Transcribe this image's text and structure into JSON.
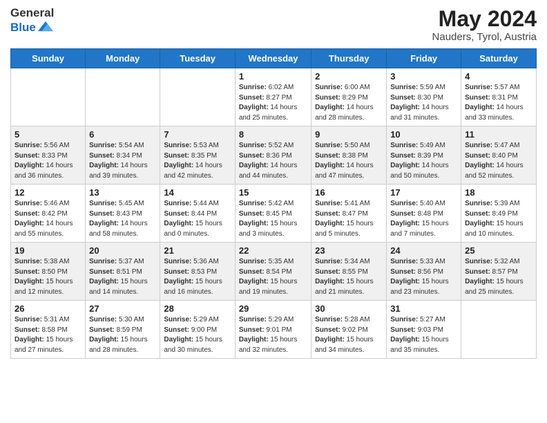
{
  "header": {
    "logo_text_general": "General",
    "logo_text_blue": "Blue",
    "month_year": "May 2024",
    "location": "Nauders, Tyrol, Austria"
  },
  "weekdays": [
    "Sunday",
    "Monday",
    "Tuesday",
    "Wednesday",
    "Thursday",
    "Friday",
    "Saturday"
  ],
  "weeks": [
    [
      {
        "day": "",
        "info": ""
      },
      {
        "day": "",
        "info": ""
      },
      {
        "day": "",
        "info": ""
      },
      {
        "day": "1",
        "info": "Sunrise: 6:02 AM\nSunset: 8:27 PM\nDaylight: 14 hours and 25 minutes."
      },
      {
        "day": "2",
        "info": "Sunrise: 6:00 AM\nSunset: 8:29 PM\nDaylight: 14 hours and 28 minutes."
      },
      {
        "day": "3",
        "info": "Sunrise: 5:59 AM\nSunset: 8:30 PM\nDaylight: 14 hours and 31 minutes."
      },
      {
        "day": "4",
        "info": "Sunrise: 5:57 AM\nSunset: 8:31 PM\nDaylight: 14 hours and 33 minutes."
      }
    ],
    [
      {
        "day": "5",
        "info": "Sunrise: 5:56 AM\nSunset: 8:33 PM\nDaylight: 14 hours and 36 minutes."
      },
      {
        "day": "6",
        "info": "Sunrise: 5:54 AM\nSunset: 8:34 PM\nDaylight: 14 hours and 39 minutes."
      },
      {
        "day": "7",
        "info": "Sunrise: 5:53 AM\nSunset: 8:35 PM\nDaylight: 14 hours and 42 minutes."
      },
      {
        "day": "8",
        "info": "Sunrise: 5:52 AM\nSunset: 8:36 PM\nDaylight: 14 hours and 44 minutes."
      },
      {
        "day": "9",
        "info": "Sunrise: 5:50 AM\nSunset: 8:38 PM\nDaylight: 14 hours and 47 minutes."
      },
      {
        "day": "10",
        "info": "Sunrise: 5:49 AM\nSunset: 8:39 PM\nDaylight: 14 hours and 50 minutes."
      },
      {
        "day": "11",
        "info": "Sunrise: 5:47 AM\nSunset: 8:40 PM\nDaylight: 14 hours and 52 minutes."
      }
    ],
    [
      {
        "day": "12",
        "info": "Sunrise: 5:46 AM\nSunset: 8:42 PM\nDaylight: 14 hours and 55 minutes."
      },
      {
        "day": "13",
        "info": "Sunrise: 5:45 AM\nSunset: 8:43 PM\nDaylight: 14 hours and 58 minutes."
      },
      {
        "day": "14",
        "info": "Sunrise: 5:44 AM\nSunset: 8:44 PM\nDaylight: 15 hours and 0 minutes."
      },
      {
        "day": "15",
        "info": "Sunrise: 5:42 AM\nSunset: 8:45 PM\nDaylight: 15 hours and 3 minutes."
      },
      {
        "day": "16",
        "info": "Sunrise: 5:41 AM\nSunset: 8:47 PM\nDaylight: 15 hours and 5 minutes."
      },
      {
        "day": "17",
        "info": "Sunrise: 5:40 AM\nSunset: 8:48 PM\nDaylight: 15 hours and 7 minutes."
      },
      {
        "day": "18",
        "info": "Sunrise: 5:39 AM\nSunset: 8:49 PM\nDaylight: 15 hours and 10 minutes."
      }
    ],
    [
      {
        "day": "19",
        "info": "Sunrise: 5:38 AM\nSunset: 8:50 PM\nDaylight: 15 hours and 12 minutes."
      },
      {
        "day": "20",
        "info": "Sunrise: 5:37 AM\nSunset: 8:51 PM\nDaylight: 15 hours and 14 minutes."
      },
      {
        "day": "21",
        "info": "Sunrise: 5:36 AM\nSunset: 8:53 PM\nDaylight: 15 hours and 16 minutes."
      },
      {
        "day": "22",
        "info": "Sunrise: 5:35 AM\nSunset: 8:54 PM\nDaylight: 15 hours and 19 minutes."
      },
      {
        "day": "23",
        "info": "Sunrise: 5:34 AM\nSunset: 8:55 PM\nDaylight: 15 hours and 21 minutes."
      },
      {
        "day": "24",
        "info": "Sunrise: 5:33 AM\nSunset: 8:56 PM\nDaylight: 15 hours and 23 minutes."
      },
      {
        "day": "25",
        "info": "Sunrise: 5:32 AM\nSunset: 8:57 PM\nDaylight: 15 hours and 25 minutes."
      }
    ],
    [
      {
        "day": "26",
        "info": "Sunrise: 5:31 AM\nSunset: 8:58 PM\nDaylight: 15 hours and 27 minutes."
      },
      {
        "day": "27",
        "info": "Sunrise: 5:30 AM\nSunset: 8:59 PM\nDaylight: 15 hours and 28 minutes."
      },
      {
        "day": "28",
        "info": "Sunrise: 5:29 AM\nSunset: 9:00 PM\nDaylight: 15 hours and 30 minutes."
      },
      {
        "day": "29",
        "info": "Sunrise: 5:29 AM\nSunset: 9:01 PM\nDaylight: 15 hours and 32 minutes."
      },
      {
        "day": "30",
        "info": "Sunrise: 5:28 AM\nSunset: 9:02 PM\nDaylight: 15 hours and 34 minutes."
      },
      {
        "day": "31",
        "info": "Sunrise: 5:27 AM\nSunset: 9:03 PM\nDaylight: 15 hours and 35 minutes."
      },
      {
        "day": "",
        "info": ""
      }
    ]
  ]
}
